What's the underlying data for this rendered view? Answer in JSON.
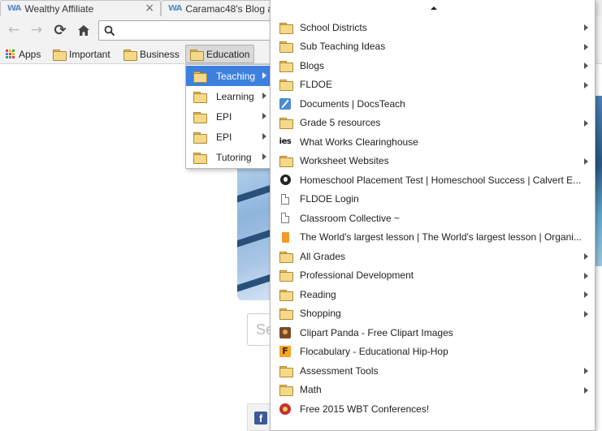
{
  "tabs": [
    {
      "favicon": "WA",
      "title": "Wealthy Affiliate",
      "close": "×"
    },
    {
      "favicon": "WA",
      "title": "Caramac48's Blog a"
    }
  ],
  "toolbar": {
    "back_icon": "←",
    "forward_icon": "→",
    "reload_icon": "⟳"
  },
  "bookmarks_bar": {
    "apps_label": "Apps",
    "items": [
      "Important",
      "Business",
      "Education"
    ]
  },
  "page": {
    "search_placeholder": "Se",
    "facebook_icon": "f"
  },
  "education_menu": {
    "items": [
      {
        "label": "Teaching",
        "submenu": true,
        "highlighted": true
      },
      {
        "label": "Learning",
        "submenu": true
      },
      {
        "label": "EPI",
        "submenu": true
      },
      {
        "label": "EPI",
        "submenu": true
      },
      {
        "label": "Tutoring",
        "submenu": true
      }
    ]
  },
  "teaching_menu": {
    "scroll_up_icon": "triangle-up-icon",
    "items": [
      {
        "label": "School Districts",
        "icon": "folder-icon",
        "submenu": true
      },
      {
        "label": "Sub Teaching Ideas",
        "icon": "folder-icon",
        "submenu": true
      },
      {
        "label": "Blogs",
        "icon": "folder-icon",
        "submenu": true
      },
      {
        "label": "FLDOE",
        "icon": "folder-icon",
        "submenu": true
      },
      {
        "label": "Documents | DocsTeach",
        "icon": "pencil-icon",
        "submenu": false
      },
      {
        "label": "Grade 5 resources",
        "icon": "folder-icon",
        "submenu": true
      },
      {
        "label": "What Works Clearinghouse",
        "icon": "ies-icon",
        "icon_text": "ies",
        "submenu": false
      },
      {
        "label": "Worksheet Websites",
        "icon": "folder-icon",
        "submenu": true
      },
      {
        "label": "Homeschool Placement Test | Homeschool Success | Calvert E...",
        "icon": "shield-icon",
        "submenu": false
      },
      {
        "label": "FLDOE Login",
        "icon": "page-icon",
        "submenu": false
      },
      {
        "label": "Classroom Collective ~",
        "icon": "page-icon",
        "submenu": false
      },
      {
        "label": "The World's largest lesson | The World's largest lesson | Organi...",
        "icon": "book-icon",
        "submenu": false
      },
      {
        "label": "All Grades",
        "icon": "folder-icon",
        "submenu": true
      },
      {
        "label": "Professional Development",
        "icon": "folder-icon",
        "submenu": true
      },
      {
        "label": "Reading",
        "icon": "folder-icon",
        "submenu": true
      },
      {
        "label": "Shopping",
        "icon": "folder-icon",
        "submenu": true
      },
      {
        "label": "Clipart Panda - Free Clipart Images",
        "icon": "panda-icon",
        "submenu": false
      },
      {
        "label": "Flocabulary - Educational Hip-Hop",
        "icon": "flocabulary-icon",
        "icon_text": "F",
        "submenu": false
      },
      {
        "label": "Assessment Tools",
        "icon": "folder-icon",
        "submenu": true
      },
      {
        "label": "Math",
        "icon": "folder-icon",
        "submenu": true
      },
      {
        "label": "Free 2015 WBT Conferences!",
        "icon": "wbt-icon",
        "submenu": false
      }
    ]
  },
  "colors": {
    "menu_highlight": "#3d80df",
    "folder": "#f4d98a",
    "facebook": "#3b5998"
  }
}
